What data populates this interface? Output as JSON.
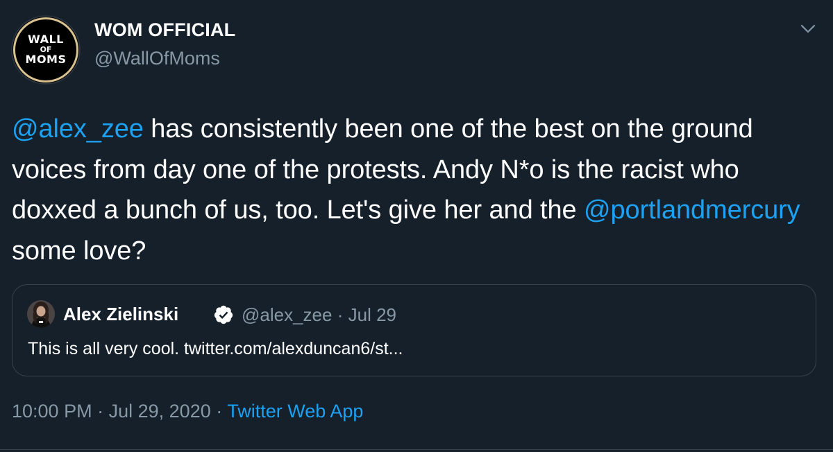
{
  "author": {
    "display_name": "WOM OFFICIAL",
    "handle": "@WallOfMoms",
    "avatar": {
      "line1": "WALL",
      "line2": "OF",
      "line3": "MOMS"
    }
  },
  "tweet": {
    "mention1": "@alex_zee",
    "text1": " has consistently been one of the best on the ground voices from day one of the protests. Andy N*o is the racist who doxxed a bunch of us, too. Let's give her and the ",
    "mention2": "@portlandmercury",
    "text2": " some love?"
  },
  "quoted_tweet": {
    "name": "Alex Zielinski",
    "handle": "@alex_zee",
    "separator": "·",
    "date": "Jul 29",
    "text": "This is all very cool. twitter.com/alexduncan6/st..."
  },
  "footer": {
    "time": "10:00 PM",
    "separator1": "·",
    "date": "Jul 29, 2020",
    "separator2": "·",
    "app": "Twitter Web App"
  },
  "icons": {
    "more": "chevron-down-icon",
    "verified": "verified-badge-icon"
  },
  "colors": {
    "background": "#15202b",
    "link": "#1da1f2",
    "secondary_text": "#8899a6",
    "border": "#38444d"
  }
}
